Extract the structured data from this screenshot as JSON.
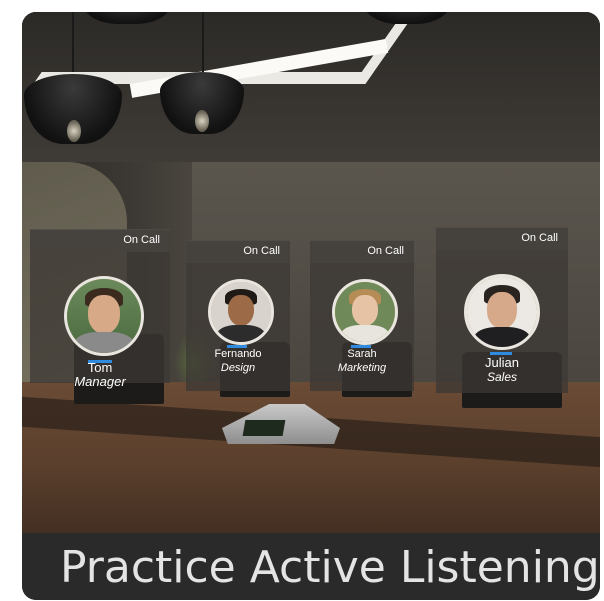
{
  "caption": {
    "text": "Practice Active Listening"
  },
  "participants": [
    {
      "name": "Tom",
      "role": "Manager",
      "status": "On Call",
      "avatar_icon": "person-avatar-icon"
    },
    {
      "name": "Fernando",
      "role": "Design",
      "status": "On Call",
      "avatar_icon": "person-avatar-icon"
    },
    {
      "name": "Sarah",
      "role": "Marketing",
      "status": "On Call",
      "avatar_icon": "person-avatar-icon"
    },
    {
      "name": "Julian",
      "role": "Sales",
      "status": "On Call",
      "avatar_icon": "person-avatar-icon"
    }
  ],
  "colors": {
    "accent_bar": "#2f8be0",
    "caption_bg": "#2a2a2a",
    "caption_text": "#e4e4e4"
  }
}
